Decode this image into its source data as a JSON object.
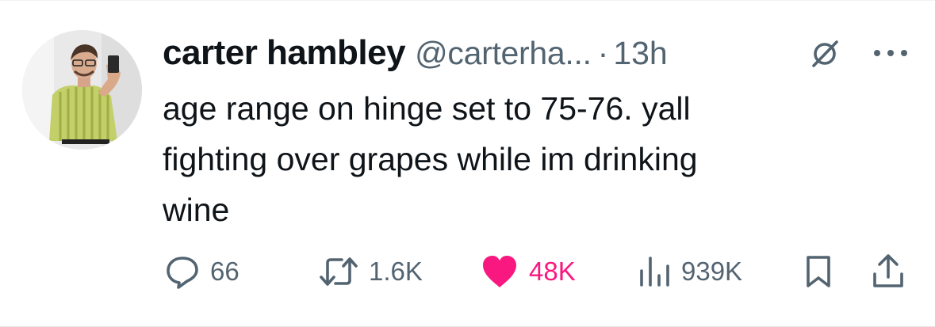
{
  "tweet": {
    "display_name": "carter hambley",
    "handle": "@carterha...",
    "separator": "·",
    "time": "13h",
    "text_lines": [
      "age range on hinge set to 75-76. yall",
      "fighting over grapes while im drinking",
      "wine"
    ]
  },
  "actions": {
    "replies": "66",
    "reposts": "1.6K",
    "likes": "48K",
    "views": "939K"
  },
  "icons": {
    "grok": "grok-icon",
    "more": "more-icon",
    "reply": "reply-icon",
    "repost": "repost-icon",
    "like": "heart-icon",
    "views": "views-icon",
    "bookmark": "bookmark-icon",
    "share": "share-icon"
  },
  "colors": {
    "text": "#0f1419",
    "secondary": "#536471",
    "like_active": "#f91880"
  }
}
